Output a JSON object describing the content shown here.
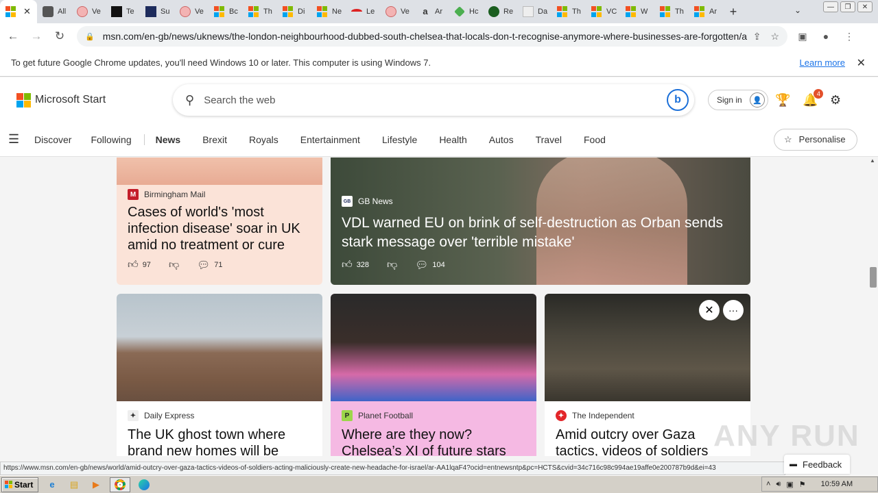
{
  "browser": {
    "tabs": [
      {
        "label": "",
        "icon": "microsoft-icon",
        "active": true
      },
      {
        "label": "All",
        "icon": "pen-icon"
      },
      {
        "label": "Ve",
        "icon": "circle-icon"
      },
      {
        "label": "Te",
        "icon": "tv-icon"
      },
      {
        "label": "Su",
        "icon": "wb-icon"
      },
      {
        "label": "Ve",
        "icon": "circle-icon"
      },
      {
        "label": "Bc",
        "icon": "microsoft-icon"
      },
      {
        "label": "Th",
        "icon": "microsoft-icon"
      },
      {
        "label": "Di",
        "icon": "microsoft-icon"
      },
      {
        "label": "Ne",
        "icon": "microsoft-icon"
      },
      {
        "label": "Le",
        "icon": "arc-icon"
      },
      {
        "label": "Ve",
        "icon": "circle-icon"
      },
      {
        "label": "Ar",
        "icon": "amazon-icon"
      },
      {
        "label": "Hc",
        "icon": "tag-icon"
      },
      {
        "label": "Re",
        "icon": "r-icon"
      },
      {
        "label": "Da",
        "icon": "cecil-icon"
      },
      {
        "label": "Th",
        "icon": "microsoft-icon"
      },
      {
        "label": "VC",
        "icon": "microsoft-icon"
      },
      {
        "label": "W",
        "icon": "microsoft-icon"
      },
      {
        "label": "Th",
        "icon": "microsoft-icon"
      },
      {
        "label": "Ar",
        "icon": "microsoft-icon"
      }
    ],
    "tab_close": "✕",
    "new_tab": "+",
    "url": "msn.com/en-gb/news/uknews/the-london-neighbourhood-dubbed-south-chelsea-that-locals-don-t-recognise-anymore-where-businesses-are-forgotten/ar-...",
    "infobar_text": "To get future Google Chrome updates, you'll need Windows 10 or later. This computer is using Windows 7.",
    "infobar_link": "Learn more",
    "status_url": "https://www.msn.com/en-gb/news/world/amid-outcry-over-gaza-tactics-videos-of-soldiers-acting-maliciously-create-new-headache-for-israel/ar-AA1lqaF4?ocid=entnewsntp&pc=HCTS&cvid=34c716c98c994ae19affe0e200787b9d&ei=43"
  },
  "msn": {
    "brand": "Microsoft Start",
    "search_placeholder": "Search the web",
    "signin": "Sign in",
    "notification_count": "4",
    "nav": [
      "Discover",
      "Following",
      "News",
      "Brexit",
      "Royals",
      "Entertainment",
      "Lifestyle",
      "Health",
      "Autos",
      "Travel",
      "Food"
    ],
    "personalise": "Personalise",
    "feedback": "Feedback"
  },
  "cards": [
    {
      "source": "Birmingham Mail",
      "headline": "Cases of world's 'most infection disease' soar in UK amid no treatment or cure",
      "likes": "97",
      "comments": "71"
    },
    {
      "source": "GB News",
      "headline": "VDL warned EU on brink of self-destruction as Orban sends stark message over 'terrible mistake'",
      "likes": "328",
      "comments": "104"
    },
    {
      "source": "Daily Express",
      "headline": "The UK ghost town where brand new homes will be"
    },
    {
      "source": "Planet Football",
      "headline": "Where are they now? Chelsea’s XI of future stars"
    },
    {
      "source": "The Independent",
      "headline": "Amid outcry over Gaza tactics, videos of soldiers"
    }
  ],
  "watermark": "ANY RUN",
  "taskbar": {
    "start": "Start",
    "time": "10:59 AM"
  },
  "colors": {
    "ms_red": "#f25022",
    "ms_green": "#7fba00",
    "ms_blue": "#00a4ef",
    "ms_yellow": "#ffb900",
    "card1_bg": "#fbe3d8",
    "card4_bg": "#f5b9e3",
    "link_blue": "#1a73e8"
  }
}
